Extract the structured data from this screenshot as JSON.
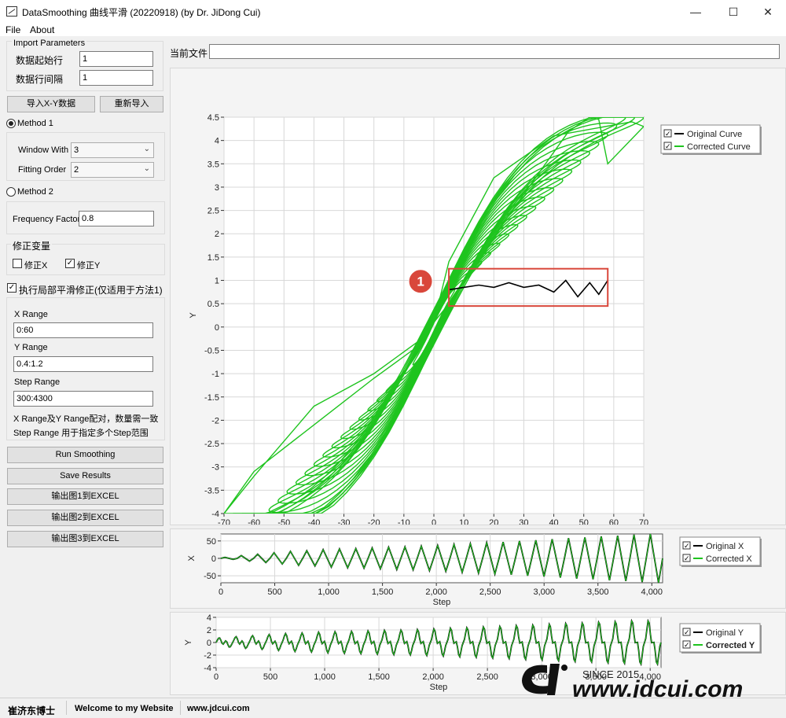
{
  "window": {
    "title": "DataSmoothing 曲线平滑 (20220918) (by Dr. JiDong Cui)",
    "minimize": "—",
    "maximize": "☐",
    "close": "✕"
  },
  "menu": {
    "file": "File",
    "about": "About"
  },
  "import": {
    "group_label": "Import Parameters",
    "start_row_label": "数据起始行",
    "start_row_value": "1",
    "row_interval_label": "数据行间隔",
    "row_interval_value": "1",
    "import_button": "导入X-Y数据",
    "reimport_button": "重新导入"
  },
  "method1": {
    "label": "Method 1",
    "window_label": "Window With",
    "window_value": "3",
    "order_label": "Fitting Order",
    "order_value": "2",
    "selected": true
  },
  "method2": {
    "label": "Method 2",
    "freq_label": "Frequency Factor",
    "freq_value": "0.8",
    "selected": false
  },
  "correction": {
    "group_label": "修正变量",
    "x_label": "修正X",
    "x_checked": false,
    "y_label": "修正Y",
    "y_checked": true
  },
  "local": {
    "label": "执行局部平滑修正(仅适用于方法1)",
    "checked": true,
    "x_range_label": "X Range",
    "x_range_value": "0:60",
    "y_range_label": "Y Range",
    "y_range_value": "0.4:1.2",
    "step_range_label": "Step Range",
    "step_range_value": "300:4300",
    "note1": "X Range及Y Range配对，数量需一致",
    "note2": "Step Range 用于指定多个Step范围"
  },
  "actions": {
    "run": "Run Smoothing",
    "save": "Save Results",
    "export1": "输出图1到EXCEL",
    "export2": "输出图2到EXCEL",
    "export3": "输出图3到EXCEL"
  },
  "current_file": {
    "label": "当前文件",
    "value": ""
  },
  "annotation": {
    "marker": "1"
  },
  "statusbar": {
    "author": "崔济东博士",
    "welcome": "Welcome to my Website",
    "site": "www.jdcui.com"
  },
  "watermark": {
    "since": "SINCE 2015",
    "url": "www.jdcui.com"
  },
  "colors": {
    "original": "#000000",
    "corrected": "#1fc41f",
    "highlight": "#d9473b"
  },
  "chart_data": [
    {
      "type": "line",
      "xlabel": "X",
      "ylabel": "Y",
      "xlim": [
        -70,
        70
      ],
      "ylim": [
        -4,
        4.5
      ],
      "xticks": [
        -70,
        -60,
        -50,
        -40,
        -30,
        -20,
        -10,
        0,
        10,
        20,
        30,
        40,
        50,
        60,
        70
      ],
      "yticks": [
        -4,
        -3.5,
        -3,
        -2.5,
        -2,
        -1.5,
        -1,
        -0.5,
        0,
        0.5,
        1,
        1.5,
        2,
        2.5,
        3,
        3.5,
        4,
        4.5
      ],
      "xtick_labels": [
        "-70",
        "-60",
        "-50",
        "-40",
        "-30",
        "-20",
        "-10",
        "0",
        "10",
        "20",
        "30",
        "40",
        "50",
        "60",
        "70"
      ],
      "ytick_labels": [
        "-4",
        "-3.5",
        "-3",
        "-2.5",
        "-2",
        "-1.5",
        "-1",
        "-0.5",
        "0",
        "0.5",
        "1",
        "1.5",
        "2",
        "2.5",
        "3",
        "3.5",
        "4",
        "4.5"
      ],
      "grid": true,
      "legend_position": "top-right",
      "series": [
        {
          "name": "Original Curve",
          "color": "#000000",
          "x": [
            5,
            10,
            15,
            20,
            25,
            30,
            35,
            40,
            44,
            48,
            52,
            55,
            58
          ],
          "y": [
            0.8,
            0.85,
            0.9,
            0.85,
            0.95,
            0.85,
            0.9,
            0.75,
            1.0,
            0.65,
            0.95,
            0.7,
            1.0
          ]
        },
        {
          "name": "Corrected Curve",
          "color": "#1fc41f",
          "x": [
            -70,
            -60,
            -40,
            -20,
            -5,
            0,
            5,
            15,
            25,
            35,
            45,
            52,
            55,
            58,
            70,
            66,
            40,
            20,
            5,
            0,
            -5,
            -20,
            -40,
            -60,
            -70
          ],
          "y": [
            -4,
            -3.2,
            -1.7,
            -1.0,
            -0.3,
            0.1,
            0.5,
            1.4,
            2.4,
            3.3,
            4.2,
            4.5,
            4.45,
            3.5,
            4.3,
            4.4,
            4.1,
            3.2,
            1.4,
            0.1,
            -0.4,
            -1.1,
            -2.1,
            -3.1,
            -4
          ]
        }
      ],
      "highlight_box": {
        "x": [
          5,
          58
        ],
        "y": [
          0.45,
          1.25
        ]
      }
    },
    {
      "type": "line",
      "xlabel": "Step",
      "ylabel": "X",
      "xlim": [
        0,
        4100
      ],
      "ylim": [
        -70,
        70
      ],
      "xticks": [
        0,
        500,
        1000,
        1500,
        2000,
        2500,
        3000,
        3500,
        4000
      ],
      "yticks": [
        -50,
        0,
        50
      ],
      "xtick_labels": [
        "0",
        "500",
        "1,000",
        "1,500",
        "2,000",
        "2,500",
        "3,000",
        "3,500",
        "4,000"
      ],
      "ytick_labels": [
        "-50",
        "0",
        "50"
      ],
      "grid": true,
      "legend_position": "right",
      "series": [
        {
          "name": "Original X",
          "color": "#000000",
          "amplitude": [
            3,
            8,
            12,
            16,
            20,
            22,
            25,
            27,
            28,
            30,
            32,
            33,
            35,
            37,
            40,
            42,
            45,
            47,
            50,
            52,
            55,
            58,
            60,
            63,
            65,
            68,
            70
          ]
        },
        {
          "name": "Corrected X",
          "color": "#1fc41f"
        }
      ]
    },
    {
      "type": "line",
      "xlabel": "Step",
      "ylabel": "Y",
      "xlim": [
        0,
        4100
      ],
      "ylim": [
        -4,
        4
      ],
      "xticks": [
        0,
        500,
        1000,
        1500,
        2000,
        2500,
        3000,
        3500,
        4000
      ],
      "yticks": [
        -4,
        -2,
        0,
        2,
        4
      ],
      "xtick_labels": [
        "0",
        "500",
        "1,000",
        "1,500",
        "2,000",
        "2,500",
        "3,000",
        "3,500",
        "4,000"
      ],
      "ytick_labels": [
        "-4",
        "-2",
        "0",
        "2",
        "4"
      ],
      "grid": true,
      "legend_position": "right",
      "series": [
        {
          "name": "Original Y",
          "color": "#000000"
        },
        {
          "name": "Corrected Y",
          "color": "#1fc41f"
        }
      ]
    }
  ]
}
